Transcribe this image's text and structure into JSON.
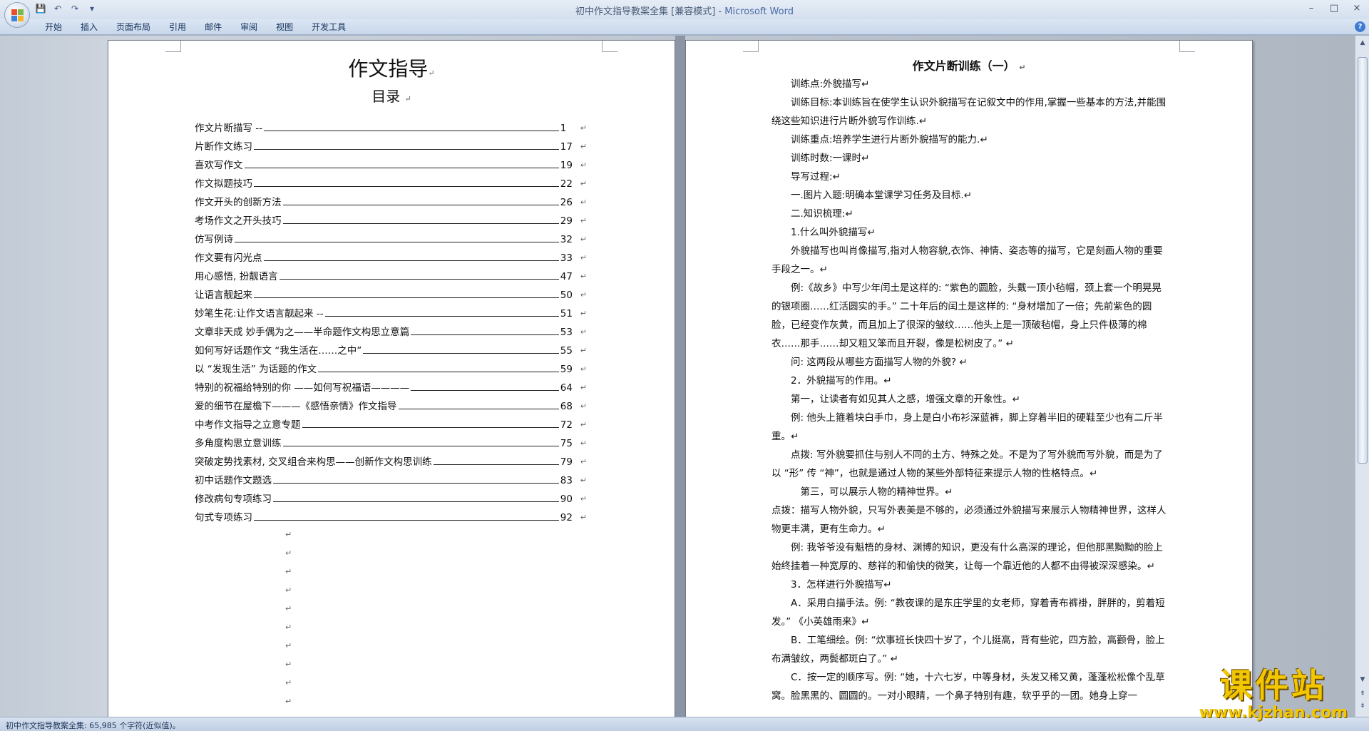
{
  "window": {
    "title": "初中作文指导教案全集 [兼容模式] - ",
    "app_name": "Microsoft Word"
  },
  "qat": {
    "save": "💾",
    "undo": "↶",
    "redo": "↷",
    "more": "▾"
  },
  "window_controls": {
    "minimize": "–",
    "restore": "□",
    "close": "×"
  },
  "ribbon": {
    "tabs": [
      "开始",
      "插入",
      "页面布局",
      "引用",
      "邮件",
      "审阅",
      "视图",
      "开发工具"
    ],
    "help": "?"
  },
  "left_page": {
    "title": "作文指导",
    "subtitle": "目录",
    "toc": [
      {
        "title": "作文片断描写 --",
        "page": "1"
      },
      {
        "title": "片断作文练习",
        "page": "17"
      },
      {
        "title": "喜欢写作文",
        "page": "19"
      },
      {
        "title": "作文拟题技巧",
        "page": "22"
      },
      {
        "title": "作文开头的创新方法",
        "page": "26"
      },
      {
        "title": "考场作文之开头技巧",
        "page": "29"
      },
      {
        "title": "仿写例诗",
        "page": "32"
      },
      {
        "title": "作文要有闪光点",
        "page": "33"
      },
      {
        "title": "用心感悟, 扮靓语言",
        "page": "47"
      },
      {
        "title": "让语言靓起来",
        "page": "50"
      },
      {
        "title": "妙笔生花:让作文语言靓起来 --",
        "page": "51"
      },
      {
        "title": "文章非天成  妙手偶为之——半命题作文构思立意篇",
        "page": "53"
      },
      {
        "title": "如何写好话题作文 “我生活在……之中”",
        "page": "55"
      },
      {
        "title": "以 “发现生活” 为话题的作文",
        "page": "59"
      },
      {
        "title": "特别的祝福给特别的你 ——如何写祝福语————",
        "page": "64"
      },
      {
        "title": "爱的细节在屋檐下———《感悟亲情》作文指导",
        "page": "68"
      },
      {
        "title": "中考作文指导之立意专题",
        "page": "72"
      },
      {
        "title": "多角度构思立意训练",
        "page": "75"
      },
      {
        "title": "突破定势找素材, 交叉组合来构思——创新作文构思训练",
        "page": "79"
      },
      {
        "title": "初中话题作文题选",
        "page": "83"
      },
      {
        "title": "修改病句专项练习",
        "page": "90"
      },
      {
        "title": "句式专项练习",
        "page": "92"
      }
    ],
    "empty_marks": [
      "↵",
      "↵",
      "↵",
      "↵",
      "↵",
      "↵",
      "↵",
      "↵",
      "↵",
      "↵"
    ]
  },
  "right_page": {
    "title": "作文片断训练（一）",
    "paragraphs": [
      "训练点:外貌描写↵",
      "训练目标:本训练旨在使学生认识外貌描写在记叙文中的作用,掌握一些基本的方法,并能围绕这些知识进行片断外貌写作训练.↵",
      "训练重点:培养学生进行片断外貌描写的能力.↵",
      "训练时数:一课时↵",
      "导写过程:↵",
      "一.图片入题:明确本堂课学习任务及目标.↵",
      "二.知识梳理:↵",
      "1.什么叫外貌描写↵",
      "外貌描写也叫肖像描写,指对人物容貌,衣饰、神情、姿态等的描写，它是刻画人物的重要手段之一。↵",
      "例:《故乡》中写少年闰土是这样的: “紫色的圆脸，头戴一顶小毡帽，颈上套一个明晃晃的银项圈……红活圆实的手。” 二十年后的闰土是这样的: “身材增加了一倍；先前紫色的圆脸，已经变作灰黄，而且加上了很深的皱纹……他头上是一顶破毡帽，身上只件极薄的棉衣……那手……却又粗又笨而且开裂，像是松树皮了。” ↵",
      "问: 这两段从哪些方面描写人物的外貌? ↵",
      "2．外貌描写的作用。↵",
      "第一，让读者有如见其人之感，增强文章的开象性。↵",
      "例: 他头上箍着块白手巾，身上是白小布衫深蓝裤，脚上穿着半旧的硬鞋至少也有二斤半重。↵",
      "点拨: 写外貌要抓住与别人不同的土方、特殊之处。不是为了写外貌而写外貌，而是为了以 “形” 传 “神”，也就是通过人物的某些外部特征来提示人物的性格特点。↵",
      "第三，可以展示人物的精神世界。↵",
      "点拨：描写人物外貌，只写外表美是不够的，必须通过外貌描写来展示人物精神世界，这样人物更丰满，更有生命力。↵",
      "例: 我爷爷没有魁梧的身材、渊博的知识，更没有什么高深的理论，但他那黑黝黝的脸上始终挂着一种宽厚的、慈祥的和偷快的微笑，让每一个靠近他的人都不由得被深深感染。↵",
      "3．怎样进行外貌描写↵",
      "A．采用白描手法。例: “教夜课的是东庄学里的女老师，穿着青布裤褂，胖胖的，剪着短发。” 《小英雄雨来》↵",
      "B．工笔细绘。例: “炊事班长快四十岁了，个儿挺高，背有些驼，四方脸，高颧骨，脸上布满皱纹，两鬓都斑白了。” ↵",
      "C．按一定的顺序写。例: “她，十六七岁，中等身材，头发又稀又黄，蓬蓬松松像个乱草窝。脸黑黑的、圆圆的。一对小眼睛，一个鼻子特别有趣，软乎乎的一团。她身上穿一"
    ]
  },
  "status_bar": {
    "text": "初中作文指导教案全集: 65,985 个字符(近似值)。"
  },
  "watermark": {
    "text": "课件站",
    "url": "www.kjzhan.com"
  }
}
